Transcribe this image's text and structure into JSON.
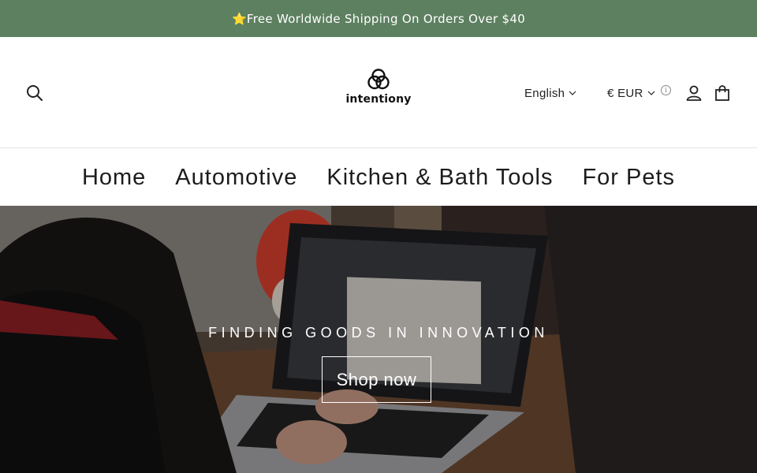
{
  "announcement": {
    "text": "⭐Free Worldwide Shipping On Orders Over $40"
  },
  "header": {
    "logo_text": "intentiony",
    "language": "English",
    "currency": "€ EUR",
    "info_symbol": "i"
  },
  "icons": {
    "search": "search-icon",
    "account": "user-icon",
    "cart": "shopping-bag-icon",
    "chevron": "chevron-down-icon",
    "info": "info-icon",
    "logo": "triple-ring-logo"
  },
  "nav": {
    "items": [
      {
        "label": "Home"
      },
      {
        "label": "Automotive"
      },
      {
        "label": "Kitchen & Bath Tools"
      },
      {
        "label": "For Pets"
      }
    ]
  },
  "hero": {
    "tagline": "FINDING GOODS IN INNOVATION",
    "cta_label": "Shop now"
  },
  "colors": {
    "announcement_bg": "#5d8060",
    "announcement_text": "#ffffff",
    "text": "#1c1c1c",
    "border": "#e2e2e2"
  }
}
